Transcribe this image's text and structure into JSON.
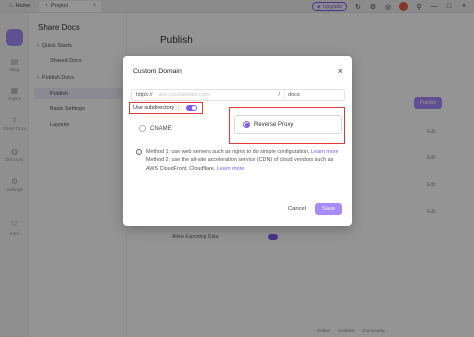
{
  "titlebar": {
    "tabs": [
      {
        "label": "Home",
        "icon": "home-icon"
      },
      {
        "label": "Project",
        "icon": "project-icon"
      }
    ],
    "upgrade_label": "Upgrade"
  },
  "iconbar": {
    "items": [
      "Blog",
      "Topics",
      "Share Docs",
      "Directory",
      "Settings",
      "Intro"
    ]
  },
  "sidenav": {
    "title": "Share Docs",
    "items": [
      "Quick Starts",
      "Shared Docs",
      "Publish Docs",
      "Publish",
      "Basic Settings",
      "Layouts"
    ]
  },
  "main": {
    "title": "Publish",
    "publish_button": "Publish",
    "edit_label": "Edit",
    "allow_label": "Allow Exporting Data",
    "footer": [
      "Online",
      "Cookies",
      "Community"
    ]
  },
  "modal": {
    "title": "Custom Domain",
    "scheme": "https://",
    "domain_placeholder": "doc.yourdomain.com",
    "slash": "/",
    "path_value": "docs",
    "subdirectory_label": "Use subdirectory",
    "option_cname": "CNAME",
    "option_proxy": "Reverse Proxy",
    "method1_text": "Method 1: use web servers such as nginx to do simple configuration.",
    "method1_link": "Learn more",
    "method2_text": "Method 2: use the all-site acceleration service (CDN) of cloud vendors such as AWS CloudFront, Cloudflare.",
    "method2_link": "Learn more",
    "cancel_label": "Cancel",
    "save_label": "Save"
  },
  "colors": {
    "accent": "#7c5cf0",
    "accent_light": "#a78bfa",
    "highlight_box": "#e23a3a"
  }
}
